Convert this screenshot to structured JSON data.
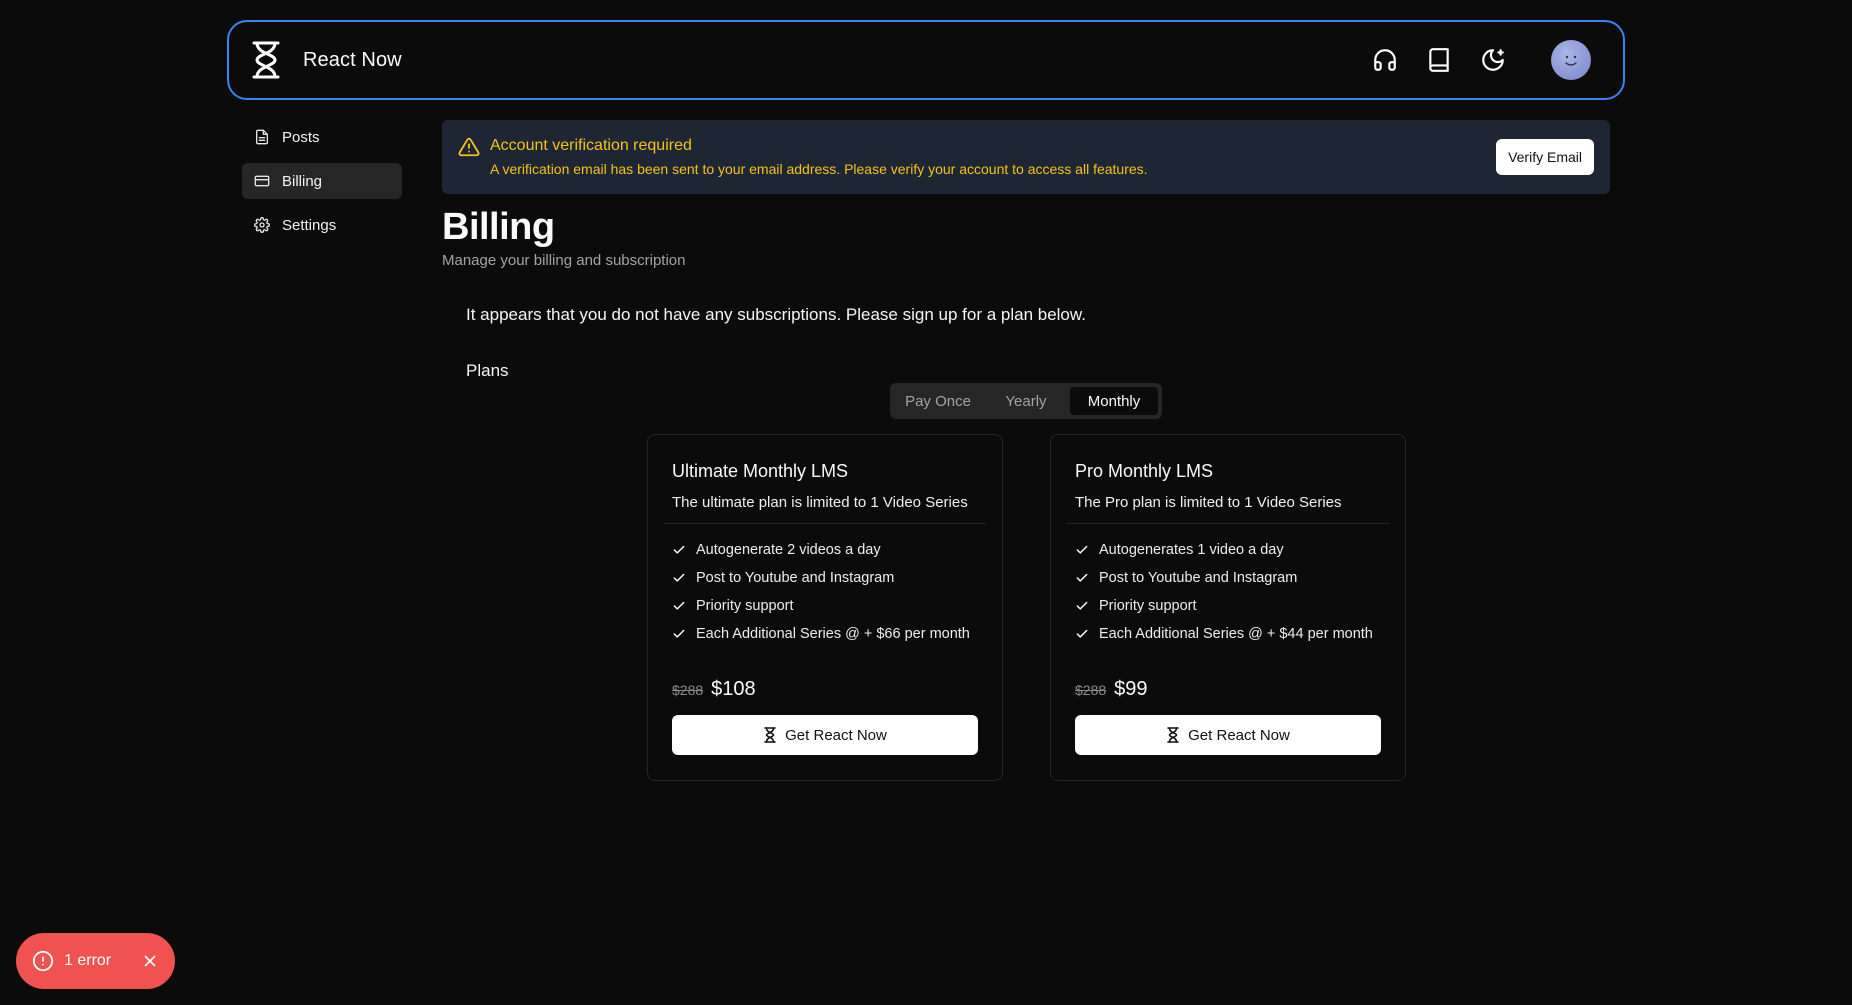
{
  "header": {
    "brand": "React Now",
    "icons": [
      "headphones-icon",
      "book-icon",
      "theme-toggle-icon"
    ],
    "accent": "#3b82f6"
  },
  "sidebar": {
    "items": [
      {
        "label": "Posts",
        "icon": "document-icon"
      },
      {
        "label": "Billing",
        "icon": "credit-card-icon",
        "active": true
      },
      {
        "label": "Settings",
        "icon": "gear-icon"
      }
    ]
  },
  "alert": {
    "title": "Account verification required",
    "description": "A verification email has been sent to your email address. Please verify your account to access all features.",
    "button": "Verify Email",
    "color": "#f4c21b"
  },
  "page": {
    "title": "Billing",
    "subtitle": "Manage your billing and subscription",
    "notice": "It appears that you do not have any subscriptions. Please sign up for a plan below.",
    "plans_label": "Plans"
  },
  "billing_period": {
    "options": [
      "Pay Once",
      "Yearly",
      "Monthly"
    ],
    "selected": "Monthly"
  },
  "plans": [
    {
      "title": "Ultimate Monthly LMS",
      "description": "The ultimate plan is limited to 1 Video Series",
      "features": [
        "Autogenerate 2 videos a day",
        "Post to Youtube and Instagram",
        "Priority support",
        "Each Additional Series @ + $66 per month"
      ],
      "old_price": "$288",
      "price": "$108",
      "cta": "Get React Now"
    },
    {
      "title": "Pro Monthly LMS",
      "description": "The Pro plan is limited to 1 Video Series",
      "features": [
        "Autogenerates 1 video a day",
        "Post to Youtube and Instagram",
        "Priority support",
        "Each Additional Series @ + $44 per month"
      ],
      "old_price": "$288",
      "price": "$99",
      "cta": "Get React Now"
    }
  ],
  "toast": {
    "text": "1 error",
    "color": "#f05252"
  }
}
